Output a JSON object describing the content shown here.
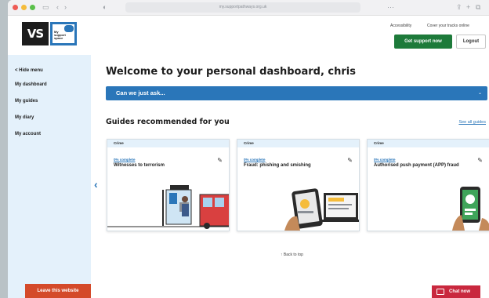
{
  "browser": {
    "url": "my.supportpathways.org.uk",
    "nav_back": "‹",
    "nav_forward": "›",
    "sidebar_glyph": "▭",
    "page_glyph": "◐",
    "tab_glyph": "⋯",
    "share_glyph": "⇪",
    "new_tab_glyph": "+",
    "tabs_glyph": "⧉"
  },
  "header": {
    "logo_text": "VS",
    "logo_box_text": "My support space",
    "accessibility_link": "Accessibility",
    "cover_tracks_link": "Cover your tracks online",
    "support_button": "Get support now",
    "logout_button": "Logout"
  },
  "sidebar": {
    "items": [
      {
        "label": "< Hide menu"
      },
      {
        "label": "My dashboard"
      },
      {
        "label": "My guides"
      },
      {
        "label": "My diary"
      },
      {
        "label": "My account"
      }
    ]
  },
  "main": {
    "welcome": "Welcome to your personal dashboard, chris",
    "ask_label": "Can we just ask...",
    "ask_chevron": "⌄",
    "guides_heading": "Guides recommended for you",
    "see_all": "See all guides",
    "prev_glyph": "‹",
    "edit_glyph": "✎",
    "back_to_top": "↑ Back to top",
    "cards": [
      {
        "tag": "Crime",
        "progress": "0% complete",
        "title": "Witnesses to terrorism"
      },
      {
        "tag": "Crime",
        "progress": "0% complete",
        "title": "Fraud: phishing and smishing"
      },
      {
        "tag": "Crime",
        "progress": "0% complete",
        "title": "Authorised push payment (APP) fraud"
      }
    ]
  },
  "footer": {
    "leave_button": "Leave this website",
    "chat_button": "Chat now"
  },
  "colors": {
    "brand_blue": "#2a76b9",
    "sidebar_bg": "#e4f1fb",
    "support_green": "#1d7a3a",
    "leave_orange": "#d44a2a",
    "chat_red": "#c9283e"
  }
}
